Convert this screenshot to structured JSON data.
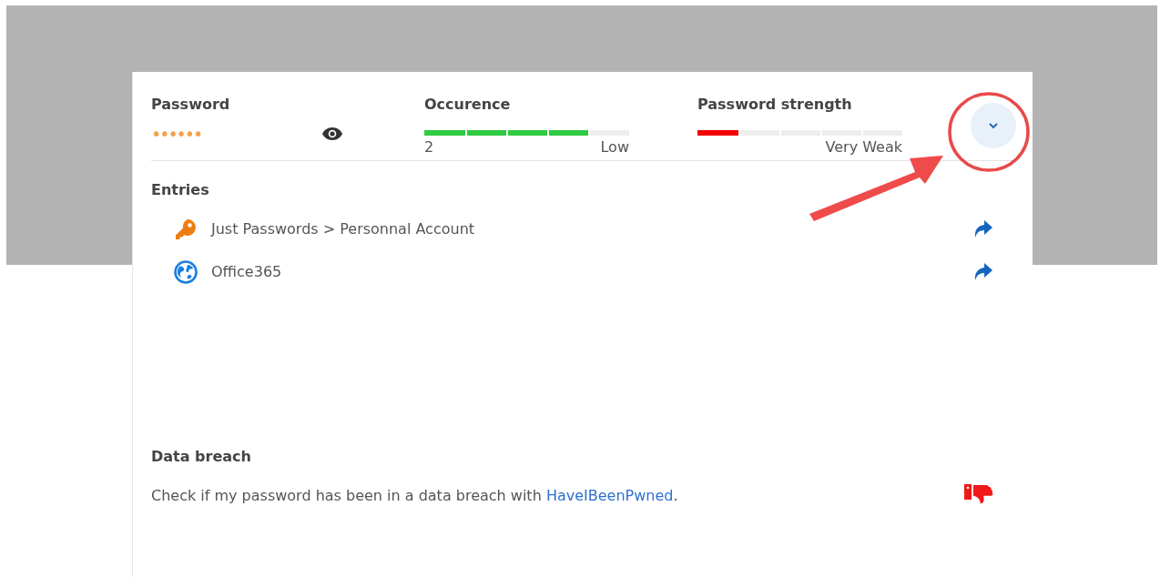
{
  "password": {
    "label": "Password",
    "value": "••••••"
  },
  "occurrence": {
    "label": "Occurence",
    "level": 0.8,
    "count": "2",
    "rating": "Low"
  },
  "strength": {
    "label": "Password strength",
    "level": 0.2,
    "rating": "Very Weak"
  },
  "expand_button": {
    "expanded": false
  },
  "entries": {
    "title": "Entries",
    "items": [
      {
        "kind": "key",
        "text": "Just Passwords > Personnal Account"
      },
      {
        "kind": "web",
        "text": "Office365"
      }
    ]
  },
  "data_breach": {
    "title": "Data breach",
    "text_before": "Check if my password has been in a data breach with ",
    "link": "HaveIBeenPwned",
    "text_after": "."
  }
}
